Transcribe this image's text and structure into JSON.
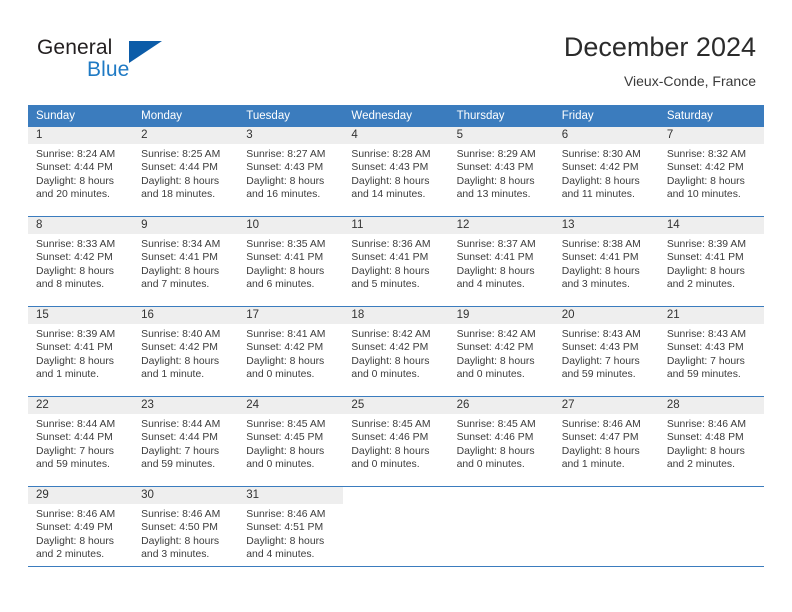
{
  "brand": {
    "name_part1": "General",
    "name_part2": "Blue",
    "triangle_icon": "triangle-icon",
    "color_dark": "#231f20",
    "color_blue": "#1f7ac4",
    "color_triangle": "#0c5ca8"
  },
  "header": {
    "title": "December 2024",
    "subtitle": "Vieux-Conde, France",
    "header_bg": "#3b7cbe",
    "daynum_bg": "#eeeeee"
  },
  "weekday_headers": [
    "Sunday",
    "Monday",
    "Tuesday",
    "Wednesday",
    "Thursday",
    "Friday",
    "Saturday"
  ],
  "weeks": [
    [
      {
        "day": "1",
        "sunrise": "Sunrise: 8:24 AM",
        "sunset": "Sunset: 4:44 PM",
        "daylight1": "Daylight: 8 hours",
        "daylight2": "and 20 minutes."
      },
      {
        "day": "2",
        "sunrise": "Sunrise: 8:25 AM",
        "sunset": "Sunset: 4:44 PM",
        "daylight1": "Daylight: 8 hours",
        "daylight2": "and 18 minutes."
      },
      {
        "day": "3",
        "sunrise": "Sunrise: 8:27 AM",
        "sunset": "Sunset: 4:43 PM",
        "daylight1": "Daylight: 8 hours",
        "daylight2": "and 16 minutes."
      },
      {
        "day": "4",
        "sunrise": "Sunrise: 8:28 AM",
        "sunset": "Sunset: 4:43 PM",
        "daylight1": "Daylight: 8 hours",
        "daylight2": "and 14 minutes."
      },
      {
        "day": "5",
        "sunrise": "Sunrise: 8:29 AM",
        "sunset": "Sunset: 4:43 PM",
        "daylight1": "Daylight: 8 hours",
        "daylight2": "and 13 minutes."
      },
      {
        "day": "6",
        "sunrise": "Sunrise: 8:30 AM",
        "sunset": "Sunset: 4:42 PM",
        "daylight1": "Daylight: 8 hours",
        "daylight2": "and 11 minutes."
      },
      {
        "day": "7",
        "sunrise": "Sunrise: 8:32 AM",
        "sunset": "Sunset: 4:42 PM",
        "daylight1": "Daylight: 8 hours",
        "daylight2": "and 10 minutes."
      }
    ],
    [
      {
        "day": "8",
        "sunrise": "Sunrise: 8:33 AM",
        "sunset": "Sunset: 4:42 PM",
        "daylight1": "Daylight: 8 hours",
        "daylight2": "and 8 minutes."
      },
      {
        "day": "9",
        "sunrise": "Sunrise: 8:34 AM",
        "sunset": "Sunset: 4:41 PM",
        "daylight1": "Daylight: 8 hours",
        "daylight2": "and 7 minutes."
      },
      {
        "day": "10",
        "sunrise": "Sunrise: 8:35 AM",
        "sunset": "Sunset: 4:41 PM",
        "daylight1": "Daylight: 8 hours",
        "daylight2": "and 6 minutes."
      },
      {
        "day": "11",
        "sunrise": "Sunrise: 8:36 AM",
        "sunset": "Sunset: 4:41 PM",
        "daylight1": "Daylight: 8 hours",
        "daylight2": "and 5 minutes."
      },
      {
        "day": "12",
        "sunrise": "Sunrise: 8:37 AM",
        "sunset": "Sunset: 4:41 PM",
        "daylight1": "Daylight: 8 hours",
        "daylight2": "and 4 minutes."
      },
      {
        "day": "13",
        "sunrise": "Sunrise: 8:38 AM",
        "sunset": "Sunset: 4:41 PM",
        "daylight1": "Daylight: 8 hours",
        "daylight2": "and 3 minutes."
      },
      {
        "day": "14",
        "sunrise": "Sunrise: 8:39 AM",
        "sunset": "Sunset: 4:41 PM",
        "daylight1": "Daylight: 8 hours",
        "daylight2": "and 2 minutes."
      }
    ],
    [
      {
        "day": "15",
        "sunrise": "Sunrise: 8:39 AM",
        "sunset": "Sunset: 4:41 PM",
        "daylight1": "Daylight: 8 hours",
        "daylight2": "and 1 minute."
      },
      {
        "day": "16",
        "sunrise": "Sunrise: 8:40 AM",
        "sunset": "Sunset: 4:42 PM",
        "daylight1": "Daylight: 8 hours",
        "daylight2": "and 1 minute."
      },
      {
        "day": "17",
        "sunrise": "Sunrise: 8:41 AM",
        "sunset": "Sunset: 4:42 PM",
        "daylight1": "Daylight: 8 hours",
        "daylight2": "and 0 minutes."
      },
      {
        "day": "18",
        "sunrise": "Sunrise: 8:42 AM",
        "sunset": "Sunset: 4:42 PM",
        "daylight1": "Daylight: 8 hours",
        "daylight2": "and 0 minutes."
      },
      {
        "day": "19",
        "sunrise": "Sunrise: 8:42 AM",
        "sunset": "Sunset: 4:42 PM",
        "daylight1": "Daylight: 8 hours",
        "daylight2": "and 0 minutes."
      },
      {
        "day": "20",
        "sunrise": "Sunrise: 8:43 AM",
        "sunset": "Sunset: 4:43 PM",
        "daylight1": "Daylight: 7 hours",
        "daylight2": "and 59 minutes."
      },
      {
        "day": "21",
        "sunrise": "Sunrise: 8:43 AM",
        "sunset": "Sunset: 4:43 PM",
        "daylight1": "Daylight: 7 hours",
        "daylight2": "and 59 minutes."
      }
    ],
    [
      {
        "day": "22",
        "sunrise": "Sunrise: 8:44 AM",
        "sunset": "Sunset: 4:44 PM",
        "daylight1": "Daylight: 7 hours",
        "daylight2": "and 59 minutes."
      },
      {
        "day": "23",
        "sunrise": "Sunrise: 8:44 AM",
        "sunset": "Sunset: 4:44 PM",
        "daylight1": "Daylight: 7 hours",
        "daylight2": "and 59 minutes."
      },
      {
        "day": "24",
        "sunrise": "Sunrise: 8:45 AM",
        "sunset": "Sunset: 4:45 PM",
        "daylight1": "Daylight: 8 hours",
        "daylight2": "and 0 minutes."
      },
      {
        "day": "25",
        "sunrise": "Sunrise: 8:45 AM",
        "sunset": "Sunset: 4:46 PM",
        "daylight1": "Daylight: 8 hours",
        "daylight2": "and 0 minutes."
      },
      {
        "day": "26",
        "sunrise": "Sunrise: 8:45 AM",
        "sunset": "Sunset: 4:46 PM",
        "daylight1": "Daylight: 8 hours",
        "daylight2": "and 0 minutes."
      },
      {
        "day": "27",
        "sunrise": "Sunrise: 8:46 AM",
        "sunset": "Sunset: 4:47 PM",
        "daylight1": "Daylight: 8 hours",
        "daylight2": "and 1 minute."
      },
      {
        "day": "28",
        "sunrise": "Sunrise: 8:46 AM",
        "sunset": "Sunset: 4:48 PM",
        "daylight1": "Daylight: 8 hours",
        "daylight2": "and 2 minutes."
      }
    ],
    [
      {
        "day": "29",
        "sunrise": "Sunrise: 8:46 AM",
        "sunset": "Sunset: 4:49 PM",
        "daylight1": "Daylight: 8 hours",
        "daylight2": "and 2 minutes."
      },
      {
        "day": "30",
        "sunrise": "Sunrise: 8:46 AM",
        "sunset": "Sunset: 4:50 PM",
        "daylight1": "Daylight: 8 hours",
        "daylight2": "and 3 minutes."
      },
      {
        "day": "31",
        "sunrise": "Sunrise: 8:46 AM",
        "sunset": "Sunset: 4:51 PM",
        "daylight1": "Daylight: 8 hours",
        "daylight2": "and 4 minutes."
      },
      {
        "day": "",
        "sunrise": "",
        "sunset": "",
        "daylight1": "",
        "daylight2": ""
      },
      {
        "day": "",
        "sunrise": "",
        "sunset": "",
        "daylight1": "",
        "daylight2": ""
      },
      {
        "day": "",
        "sunrise": "",
        "sunset": "",
        "daylight1": "",
        "daylight2": ""
      },
      {
        "day": "",
        "sunrise": "",
        "sunset": "",
        "daylight1": "",
        "daylight2": ""
      }
    ]
  ]
}
